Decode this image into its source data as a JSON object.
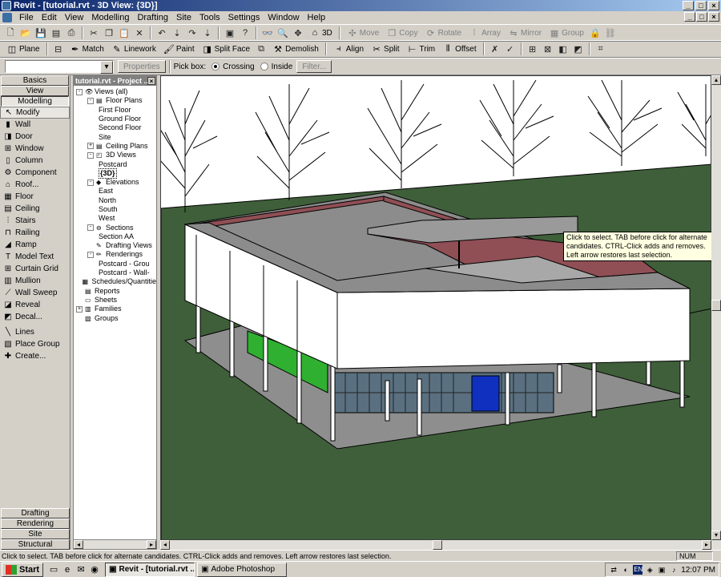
{
  "window": {
    "title": "Revit - [tutorial.rvt - 3D View: {3D}]",
    "controls": [
      "_",
      "□",
      "×"
    ]
  },
  "menu": [
    "File",
    "Edit",
    "View",
    "Modelling",
    "Drafting",
    "Site",
    "Tools",
    "Settings",
    "Window",
    "Help"
  ],
  "toolbar1": {
    "view_3d": "3D",
    "move": "Move",
    "copy": "Copy",
    "rotate": "Rotate",
    "array": "Array",
    "mirror": "Mirror",
    "group": "Group"
  },
  "toolbar2": {
    "plane": "Plane",
    "match": "Match",
    "linework": "Linework",
    "paint": "Paint",
    "split_face": "Split Face",
    "demolish": "Demolish",
    "align": "Align",
    "split": "Split",
    "trim": "Trim",
    "offset": "Offset"
  },
  "options_bar": {
    "properties": "Properties",
    "pick_box": "Pick box:",
    "crossing": "Crossing",
    "inside": "Inside",
    "filter": "Filter..."
  },
  "design_bar": {
    "tabs_top": [
      "Basics",
      "View",
      "Modelling"
    ],
    "tools": [
      {
        "label": "Modify",
        "icon": "arrow-icon"
      },
      {
        "label": "Wall",
        "icon": "wall-icon"
      },
      {
        "label": "Door",
        "icon": "door-icon"
      },
      {
        "label": "Window",
        "icon": "window-icon"
      },
      {
        "label": "Column",
        "icon": "column-icon"
      },
      {
        "label": "Component",
        "icon": "component-icon"
      },
      {
        "label": "Roof...",
        "icon": "roof-icon"
      },
      {
        "label": "Floor",
        "icon": "floor-icon"
      },
      {
        "label": "Ceiling",
        "icon": "ceiling-icon"
      },
      {
        "label": "Stairs",
        "icon": "stairs-icon"
      },
      {
        "label": "Railing",
        "icon": "railing-icon"
      },
      {
        "label": "Ramp",
        "icon": "ramp-icon"
      },
      {
        "label": "Model Text",
        "icon": "text-icon"
      },
      {
        "label": "Curtain Grid",
        "icon": "grid-icon"
      },
      {
        "label": "Mullion",
        "icon": "mullion-icon"
      },
      {
        "label": "Wall Sweep",
        "icon": "sweep-icon"
      },
      {
        "label": "Reveal",
        "icon": "reveal-icon"
      },
      {
        "label": "Decal...",
        "icon": "decal-icon"
      },
      {
        "label": "Lines",
        "icon": "lines-icon"
      },
      {
        "label": "Place Group",
        "icon": "group-icon"
      },
      {
        "label": "Create...",
        "icon": "create-icon"
      }
    ],
    "tabs_bottom": [
      "Drafting",
      "Rendering",
      "Site",
      "Structural"
    ]
  },
  "project_browser": {
    "title": "tutorial.rvt - Project ...",
    "nodes": [
      {
        "label": "Views (all)",
        "level": 0,
        "expander": "-",
        "icon": "eye-icon"
      },
      {
        "label": "Floor Plans",
        "level": 1,
        "expander": "-",
        "icon": "plan-icon"
      },
      {
        "label": "First Floor",
        "level": 2,
        "expander": "",
        "icon": ""
      },
      {
        "label": "Ground Floor",
        "level": 2,
        "expander": "",
        "icon": ""
      },
      {
        "label": "Second Floor",
        "level": 2,
        "expander": "",
        "icon": ""
      },
      {
        "label": "Site",
        "level": 2,
        "expander": "",
        "icon": ""
      },
      {
        "label": "Ceiling Plans",
        "level": 1,
        "expander": "+",
        "icon": "plan-icon"
      },
      {
        "label": "3D Views",
        "level": 1,
        "expander": "-",
        "icon": "cube-icon"
      },
      {
        "label": "Postcard",
        "level": 2,
        "expander": "",
        "icon": ""
      },
      {
        "label": "{3D}",
        "level": 2,
        "expander": "",
        "icon": "",
        "selected": true
      },
      {
        "label": "Elevations",
        "level": 1,
        "expander": "-",
        "icon": "elevation-icon"
      },
      {
        "label": "East",
        "level": 2,
        "expander": "",
        "icon": ""
      },
      {
        "label": "North",
        "level": 2,
        "expander": "",
        "icon": ""
      },
      {
        "label": "South",
        "level": 2,
        "expander": "",
        "icon": ""
      },
      {
        "label": "West",
        "level": 2,
        "expander": "",
        "icon": ""
      },
      {
        "label": "Sections",
        "level": 1,
        "expander": "-",
        "icon": "section-icon"
      },
      {
        "label": "Section AA",
        "level": 2,
        "expander": "",
        "icon": ""
      },
      {
        "label": "Drafting Views",
        "level": 1,
        "expander": "",
        "icon": "drafting-icon"
      },
      {
        "label": "Renderings",
        "level": 1,
        "expander": "-",
        "icon": "rendering-icon"
      },
      {
        "label": "Postcard - Grou",
        "level": 2,
        "expander": "",
        "icon": ""
      },
      {
        "label": "Postcard - Wall-",
        "level": 2,
        "expander": "",
        "icon": ""
      },
      {
        "label": "Schedules/Quantitie",
        "level": 0,
        "expander": "",
        "icon": "schedule-icon"
      },
      {
        "label": "Reports",
        "level": 0,
        "expander": "",
        "icon": "report-icon"
      },
      {
        "label": "Sheets",
        "level": 0,
        "expander": "",
        "icon": "sheet-icon"
      },
      {
        "label": "Families",
        "level": 0,
        "expander": "+",
        "icon": "family-icon"
      },
      {
        "label": "Groups",
        "level": 0,
        "expander": "",
        "icon": "group-icon"
      }
    ]
  },
  "tooltip": "Click to select. TAB before click for alternate candidates. CTRL-Click adds and removes. Left arrow restores last selection.",
  "status": {
    "message": "Click to select. TAB before click for alternate candidates. CTRL-Click adds and removes. Left arrow restores last selection.",
    "num": "NUM"
  },
  "taskbar": {
    "start": "Start",
    "tasks": [
      {
        "label": "Revit - [tutorial.rvt ...",
        "active": true
      },
      {
        "label": "Adobe Photoshop",
        "active": false
      }
    ],
    "lang": "EN",
    "clock": "12:07 PM"
  },
  "colors": {
    "ground": "#3f5f3a",
    "roof": "#8c8c8c",
    "roof_inner_wall": "#8f4f55",
    "wall": "#ffffff",
    "green_wall": "#30b030",
    "glass": "#5a7080",
    "door_blue": "#1030c0",
    "gravel": "#909090"
  }
}
